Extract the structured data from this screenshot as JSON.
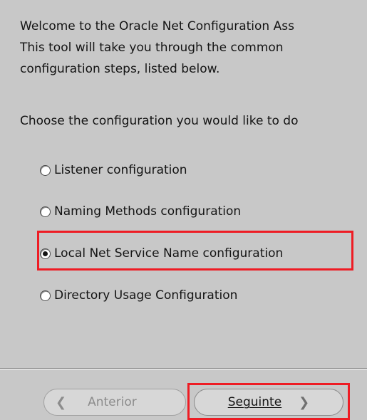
{
  "intro": {
    "line1": "Welcome to the Oracle Net Configuration Ass",
    "line2": "This tool will take you through the common",
    "line3": "configuration steps, listed below."
  },
  "question": "Choose the configuration you would like to do",
  "options": [
    {
      "label": "Listener configuration",
      "selected": false
    },
    {
      "label": "Naming Methods configuration",
      "selected": false
    },
    {
      "label": "Local Net Service Name configuration",
      "selected": true
    },
    {
      "label": "Directory Usage Configuration",
      "selected": false
    }
  ],
  "buttons": {
    "back": {
      "label": "Anterior",
      "icon": "chevron-left-icon",
      "enabled": false
    },
    "next": {
      "label": "Seguinte",
      "icon": "chevron-right-icon",
      "enabled": true
    }
  },
  "colors": {
    "background": "#c8c8c8",
    "highlight": "#ee1c24"
  }
}
